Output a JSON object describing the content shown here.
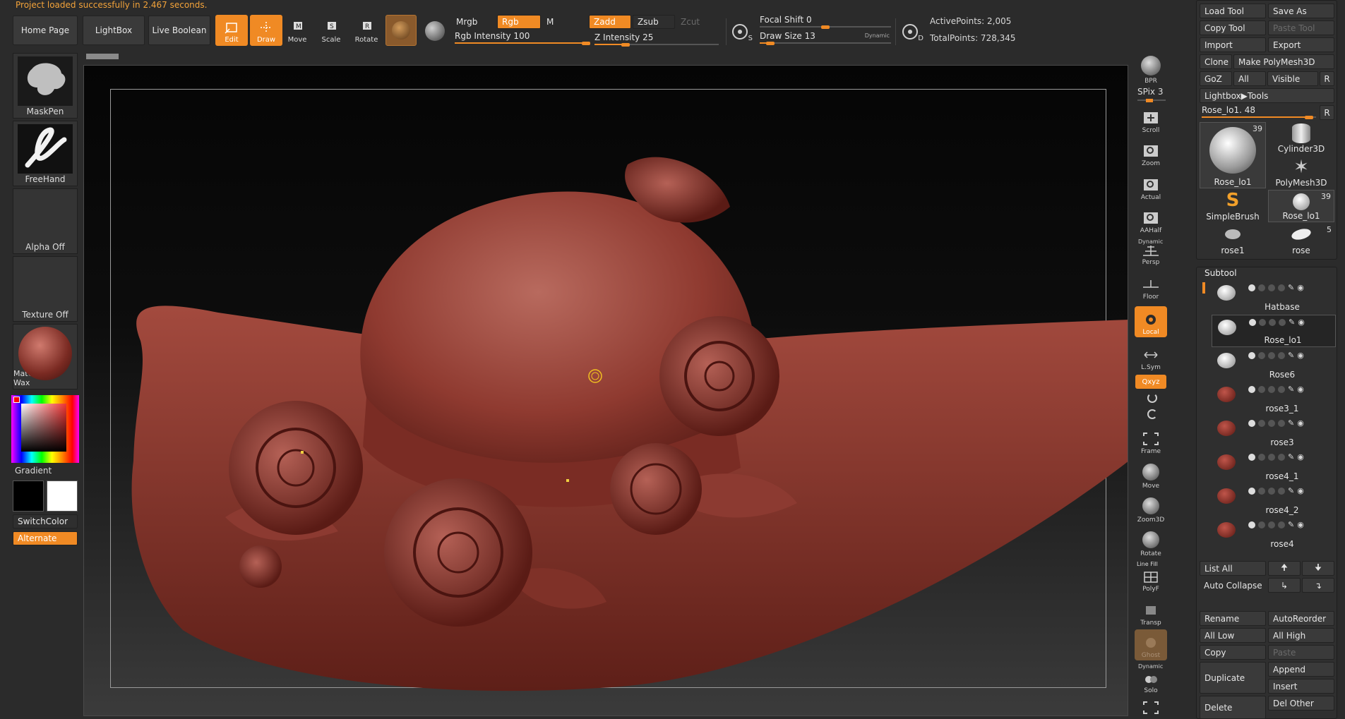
{
  "status": {
    "message": "Project loaded successfully in 2.467 seconds."
  },
  "top_buttons": {
    "home": "Home Page",
    "lightbox": "LightBox",
    "live_boolean": "Live Boolean"
  },
  "tools": {
    "edit": "Edit",
    "draw": "Draw",
    "move": "Move",
    "scale": "Scale",
    "rotate": "Rotate"
  },
  "color_modes": {
    "mrgb": "Mrgb",
    "rgb": "Rgb",
    "m": "M",
    "rgb_intensity": "Rgb Intensity 100",
    "rgb_intensity_value": 1.0
  },
  "z_modes": {
    "zadd": "Zadd",
    "zsub": "Zsub",
    "zcut": "Zcut",
    "z_intensity": "Z Intensity 25",
    "z_intensity_value": 0.25
  },
  "brush_settings": {
    "focal_shift": "Focal Shift 0",
    "focal_shift_value": 0.5,
    "draw_size": "Draw Size 13",
    "draw_size_value": 0.08,
    "dynamic": "Dynamic",
    "s_label": "S",
    "d_label": "D"
  },
  "points": {
    "active": "ActivePoints: 2,005",
    "total": "TotalPoints: 728,345"
  },
  "left_panel": {
    "brush": "MaskPen",
    "stroke": "FreeHand",
    "alpha": "Alpha Off",
    "texture": "Texture Off",
    "material": "MatCap Red Wax",
    "gradient": "Gradient",
    "switch_color": "SwitchColor",
    "alternate": "Alternate"
  },
  "nav": {
    "bpr": "BPR",
    "spix": "SPix 3",
    "scroll": "Scroll",
    "zoom": "Zoom",
    "actual": "Actual",
    "aahalf": "AAHalf",
    "dynamic": "Dynamic",
    "persp": "Persp",
    "floor": "Floor",
    "local": "Local",
    "lsym": "L.Sym",
    "xyz": "Qxyz",
    "frame": "Frame",
    "move": "Move",
    "zoom3d": "Zoom3D",
    "rotate": "Rotate",
    "line_fill": "Line Fill",
    "polyf": "PolyF",
    "transp": "Transp",
    "ghost": "Ghost",
    "dynamic2": "Dynamic",
    "solo": "Solo"
  },
  "tool_panel": {
    "load_tool": "Load Tool",
    "save_as": "Save As",
    "copy_tool": "Copy Tool",
    "paste_tool": "Paste Tool",
    "import": "Import",
    "export": "Export",
    "clone": "Clone",
    "make_polymesh": "Make PolyMesh3D",
    "goz": "GoZ",
    "all": "All",
    "visible": "Visible",
    "r": "R",
    "lightbox_tools": "Lightbox▶Tools",
    "rose_slider": "Rose_lo1. 48",
    "rose_slider_value": 0.94,
    "thumbs": [
      {
        "name": "Rose_lo1",
        "count": "39"
      },
      {
        "name": "Cylinder3D",
        "count": ""
      },
      {
        "name": "PolyMesh3D",
        "count": ""
      },
      {
        "name": "SimpleBrush",
        "count": ""
      },
      {
        "name": "Rose_lo1",
        "count": "39"
      },
      {
        "name": "rose1",
        "count": ""
      },
      {
        "name": "rose",
        "count": "5"
      }
    ]
  },
  "subtool": {
    "title": "Subtool",
    "items": [
      "Hatbase",
      "Rose_lo1",
      "Rose6",
      "rose3_1",
      "rose3",
      "rose4_1",
      "rose4_2",
      "rose4"
    ],
    "list_all": "List All",
    "auto_collapse": "Auto Collapse",
    "rename": "Rename",
    "auto_reorder": "AutoReorder",
    "all_low": "All Low",
    "all_high": "All High",
    "copy": "Copy",
    "paste": "Paste",
    "duplicate": "Duplicate",
    "append": "Append",
    "insert": "Insert",
    "delete": "Delete",
    "del_other": "Del Other"
  },
  "colors": {
    "accent": "#f08a24",
    "model": "#a9483d",
    "background": "#2b2b2b"
  }
}
